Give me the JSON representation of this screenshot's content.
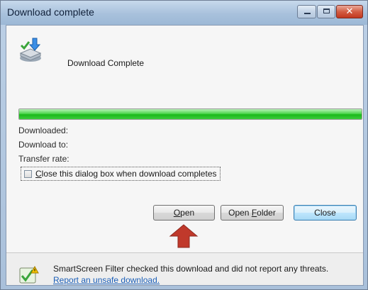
{
  "window": {
    "title": "Download complete"
  },
  "header": {
    "status_text": "Download Complete",
    "icon": "download-icon"
  },
  "progress": {
    "fraction": 1.0,
    "color": "#19b919"
  },
  "details": {
    "downloaded_label": "Downloaded:",
    "download_to_label": "Download to:",
    "transfer_rate_label": "Transfer rate:"
  },
  "options": {
    "close_when_complete": {
      "label_accel": "C",
      "label_rest": "lose this dialog box when download completes",
      "checked": false
    }
  },
  "buttons": {
    "open": {
      "accel": "O",
      "rest": "pen"
    },
    "open_folder": {
      "pre": "Open ",
      "accel": "F",
      "rest": "older"
    },
    "close": {
      "label": "Close"
    }
  },
  "footer": {
    "icon": "smartscreen-shield-icon",
    "message": "SmartScreen Filter checked this download and did not report any threats.",
    "link_text": "Report an unsafe download."
  },
  "annotation": {
    "icon": "red-up-arrow-icon",
    "color": "#c0392b"
  }
}
